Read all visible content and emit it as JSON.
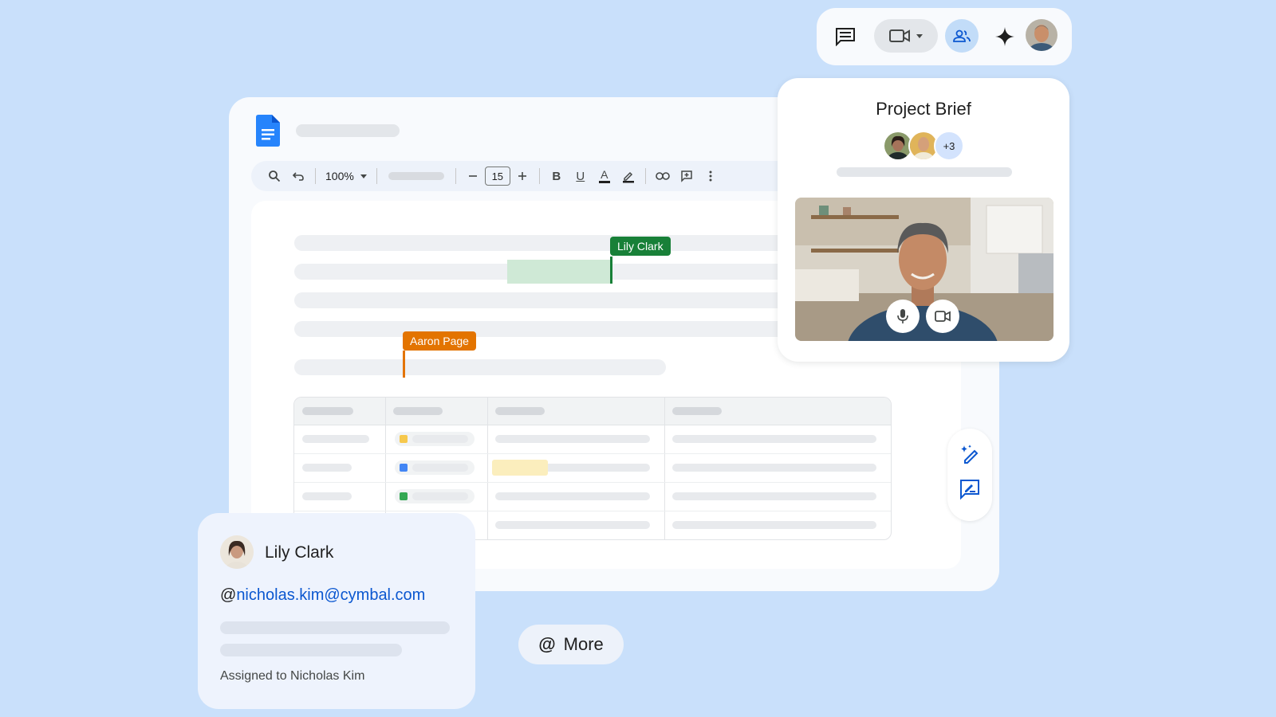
{
  "colors": {
    "background": "#c9e0fb",
    "accent_blue": "#0b57d0",
    "collaborator_green": "#188038",
    "collaborator_orange": "#e37400",
    "selection_green": "#cfe9d6"
  },
  "app_bar": {
    "icons": [
      "chat-icon",
      "video-call-icon",
      "people-icon",
      "gemini-sparkle-icon",
      "user-avatar"
    ]
  },
  "document": {
    "icon": "google-docs-icon",
    "toolbar": {
      "zoom": "100%",
      "font_size": "15",
      "icons": [
        "search-icon",
        "undo-icon",
        "minus-icon",
        "plus-icon",
        "bold-icon",
        "underline-icon",
        "text-color-icon",
        "highlight-icon",
        "link-icon",
        "comment-icon",
        "more-vert-icon"
      ],
      "bold_label": "B",
      "underline_label": "U",
      "text_color_label": "A"
    },
    "collaborators": [
      {
        "name": "Lily Clark",
        "color": "#188038"
      },
      {
        "name": "Aaron Page",
        "color": "#e37400"
      }
    ]
  },
  "meet_card": {
    "title": "Project Brief",
    "participants_extra": "+3",
    "icons": [
      "mic-icon",
      "camera-icon"
    ]
  },
  "side_rail": {
    "icons": [
      "help-me-write-icon",
      "comment-edit-icon"
    ]
  },
  "person_card": {
    "name": "Lily Clark",
    "mention_prefix": "@",
    "email": "nicholas.kim@cymbal.com",
    "assigned": "Assigned to Nicholas Kim"
  },
  "more_chip": {
    "symbol": "@",
    "label": "More"
  }
}
